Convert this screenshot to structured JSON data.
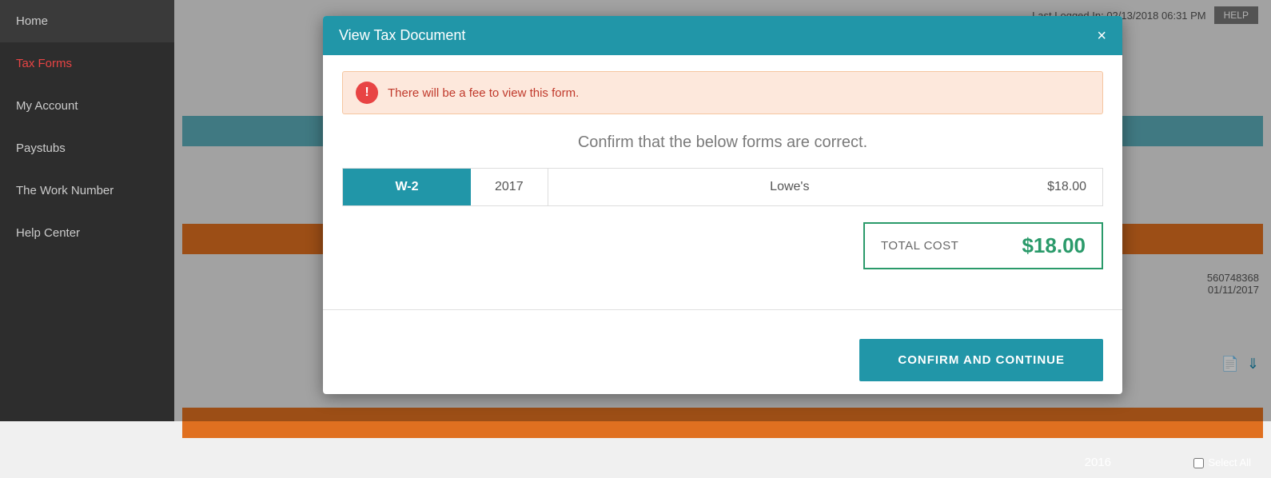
{
  "sidebar": {
    "items": [
      {
        "id": "home",
        "label": "Home",
        "active": false
      },
      {
        "id": "tax-forms",
        "label": "Tax Forms",
        "active": true
      },
      {
        "id": "my-account",
        "label": "My Account",
        "active": false
      },
      {
        "id": "paystubs",
        "label": "Paystubs",
        "active": false
      },
      {
        "id": "the-work-number",
        "label": "The Work Number",
        "active": false
      },
      {
        "id": "help-center",
        "label": "Help Center",
        "active": false
      }
    ]
  },
  "topbar": {
    "last_logged_in": "Last Logged In: 02/13/2018 06:31 PM",
    "help_label": "HELP"
  },
  "background": {
    "year_2016": "2016",
    "select_all_label": "Select All",
    "doc_number": "560748368",
    "doc_date": "01/11/2017"
  },
  "modal": {
    "title": "View Tax Document",
    "close_label": "×",
    "warning_text": "There will be a fee to view this form.",
    "confirm_heading": "Confirm that the below forms are correct.",
    "form": {
      "type": "W-2",
      "year": "2017",
      "company": "Lowe's",
      "price": "$18.00"
    },
    "total_cost": {
      "label": "TOTAL COST",
      "dollar_sign": "$",
      "amount": "18.00"
    },
    "confirm_button_label": "CONFIRM AND CONTINUE"
  }
}
